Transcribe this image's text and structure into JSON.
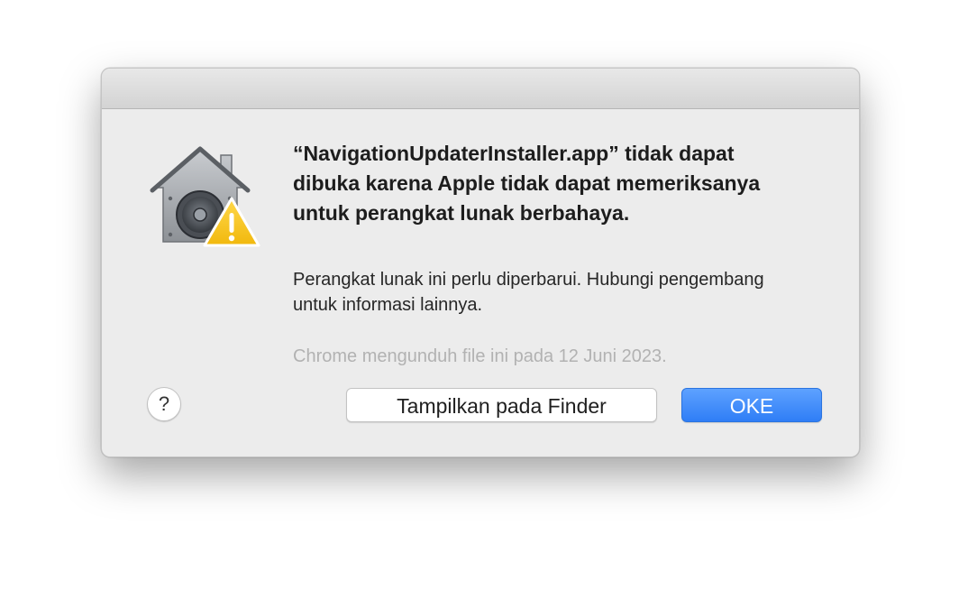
{
  "dialog": {
    "title": "“NavigationUpdaterInstaller.app” tidak dapat dibuka karena Apple tidak dapat memeriksanya untuk perangkat lunak berbahaya.",
    "message": "Perangkat lunak ini perlu diperbarui. Hubungi pengembang untuk informasi lainnya.",
    "download_note": "Chrome mengunduh file ini pada 12 Juni 2023.",
    "icon": "gatekeeper-warning-icon",
    "buttons": {
      "help_label": "?",
      "show_in_finder_label": "Tampilkan pada Finder",
      "ok_label": "OKE"
    }
  },
  "colors": {
    "accent": "#3b88f7",
    "dialog_background": "#ececec",
    "secondary_text": "#b2b2b2"
  }
}
